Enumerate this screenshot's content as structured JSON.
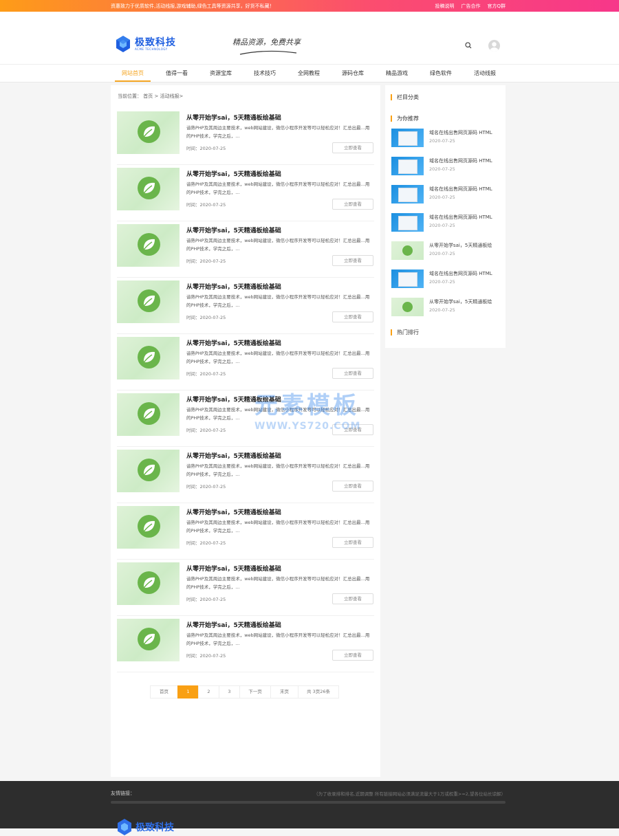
{
  "topbar": {
    "notice": "资惠致力于优质软件,活动线报,游戏辅助,绿色工具等资源共享，好货不私藏！",
    "links": [
      "投稿说明",
      "广告合作",
      "官方Q群"
    ]
  },
  "header": {
    "logo_cn": "极致科技",
    "logo_en": "ACME TECHNOLOGY",
    "slogan": "精品资源，免费共享"
  },
  "nav": [
    {
      "label": "网站首页",
      "active": true
    },
    {
      "label": "值得一看",
      "active": false
    },
    {
      "label": "资源宝库",
      "active": false
    },
    {
      "label": "技术技巧",
      "active": false
    },
    {
      "label": "全网教程",
      "active": false
    },
    {
      "label": "源码仓库",
      "active": false
    },
    {
      "label": "精品游戏",
      "active": false
    },
    {
      "label": "绿色软件",
      "active": false
    },
    {
      "label": "活动线报",
      "active": false
    }
  ],
  "breadcrumb": "当前位置： 首页 > 活动线报>",
  "posts": [
    {
      "title": "从零开始学sai，5天精通板绘基础",
      "desc": "谙熟PHP及其周边主要技术，web网站建设，微信小程序开发等可以轻松应对！汇总出最...用的PHP技术，学完之后，...",
      "time": "时间：2020-07-25",
      "button": "立即查看"
    },
    {
      "title": "从零开始学sai，5天精通板绘基础",
      "desc": "谙熟PHP及其周边主要技术，web网站建设，微信小程序开发等可以轻松应对！汇总出最...用的PHP技术，学完之后，...",
      "time": "时间：2020-07-25",
      "button": "立即查看"
    },
    {
      "title": "从零开始学sai，5天精通板绘基础",
      "desc": "谙熟PHP及其周边主要技术，web网站建设，微信小程序开发等可以轻松应对！汇总出最...用的PHP技术，学完之后，...",
      "time": "时间：2020-07-25",
      "button": "立即查看"
    },
    {
      "title": "从零开始学sai，5天精通板绘基础",
      "desc": "谙熟PHP及其周边主要技术，web网站建设，微信小程序开发等可以轻松应对！汇总出最...用的PHP技术，学完之后，...",
      "time": "时间：2020-07-25",
      "button": "立即查看"
    },
    {
      "title": "从零开始学sai，5天精通板绘基础",
      "desc": "谙熟PHP及其周边主要技术，web网站建设，微信小程序开发等可以轻松应对！汇总出最...用的PHP技术，学完之后，...",
      "time": "时间：2020-07-25",
      "button": "立即查看"
    },
    {
      "title": "从零开始学sai，5天精通板绘基础",
      "desc": "谙熟PHP及其周边主要技术，web网站建设，微信小程序开发等可以轻松应对！汇总出最...用的PHP技术，学完之后，...",
      "time": "时间：2020-07-25",
      "button": "立即查看"
    },
    {
      "title": "从零开始学sai，5天精通板绘基础",
      "desc": "谙熟PHP及其周边主要技术，web网站建设，微信小程序开发等可以轻松应对！汇总出最...用的PHP技术，学完之后，...",
      "time": "时间：2020-07-25",
      "button": "立即查看"
    },
    {
      "title": "从零开始学sai，5天精通板绘基础",
      "desc": "谙熟PHP及其周边主要技术，web网站建设，微信小程序开发等可以轻松应对！汇总出最...用的PHP技术，学完之后，...",
      "time": "时间：2020-07-25",
      "button": "立即查看"
    },
    {
      "title": "从零开始学sai，5天精通板绘基础",
      "desc": "谙熟PHP及其周边主要技术，web网站建设，微信小程序开发等可以轻松应对！汇总出最...用的PHP技术，学完之后，...",
      "time": "时间：2020-07-25",
      "button": "立即查看"
    },
    {
      "title": "从零开始学sai，5天精通板绘基础",
      "desc": "谙熟PHP及其周边主要技术，web网站建设，微信小程序开发等可以轻松应对！汇总出最...用的PHP技术，学完之后，...",
      "time": "时间：2020-07-25",
      "button": "立即查看"
    }
  ],
  "pagination": [
    "首页",
    "1",
    "2",
    "3",
    "下一页",
    "末页",
    "共 3页26条"
  ],
  "pagination_current": "1",
  "sidebar": {
    "categories_title": "栏目分类",
    "recommend_title": "为你推荐",
    "hot_title": "热门排行",
    "recommend": [
      {
        "title": "域名在线出售网页源码 HTML",
        "date": "2020-07-25",
        "thumb": "blue"
      },
      {
        "title": "域名在线出售网页源码 HTML",
        "date": "2020-07-25",
        "thumb": "blue"
      },
      {
        "title": "域名在线出售网页源码 HTML",
        "date": "2020-07-25",
        "thumb": "blue"
      },
      {
        "title": "域名在线出售网页源码 HTML",
        "date": "2020-07-25",
        "thumb": "blue"
      },
      {
        "title": "从零开始学sai，5天精通板绘",
        "date": "2020-07-25",
        "thumb": "green"
      },
      {
        "title": "域名在线出售网页源码 HTML",
        "date": "2020-07-25",
        "thumb": "blue"
      },
      {
        "title": "从零开始学sai，5天精通板绘",
        "date": "2020-07-25",
        "thumb": "green"
      }
    ]
  },
  "watermark": {
    "big": "元素模板",
    "small": "WWW.YS720.COM"
  },
  "footer": {
    "links_label": "友情链接：",
    "note": "（为了收录排和排名,近期调整 所有链接网站必须满足流量大于1万或权重>=2,望各位站长谅解）",
    "logo_cn": "极致科技"
  },
  "colors": {
    "accent": "#f9a014",
    "brand": "#1f5fe0",
    "leaf": "#6ab54b"
  }
}
